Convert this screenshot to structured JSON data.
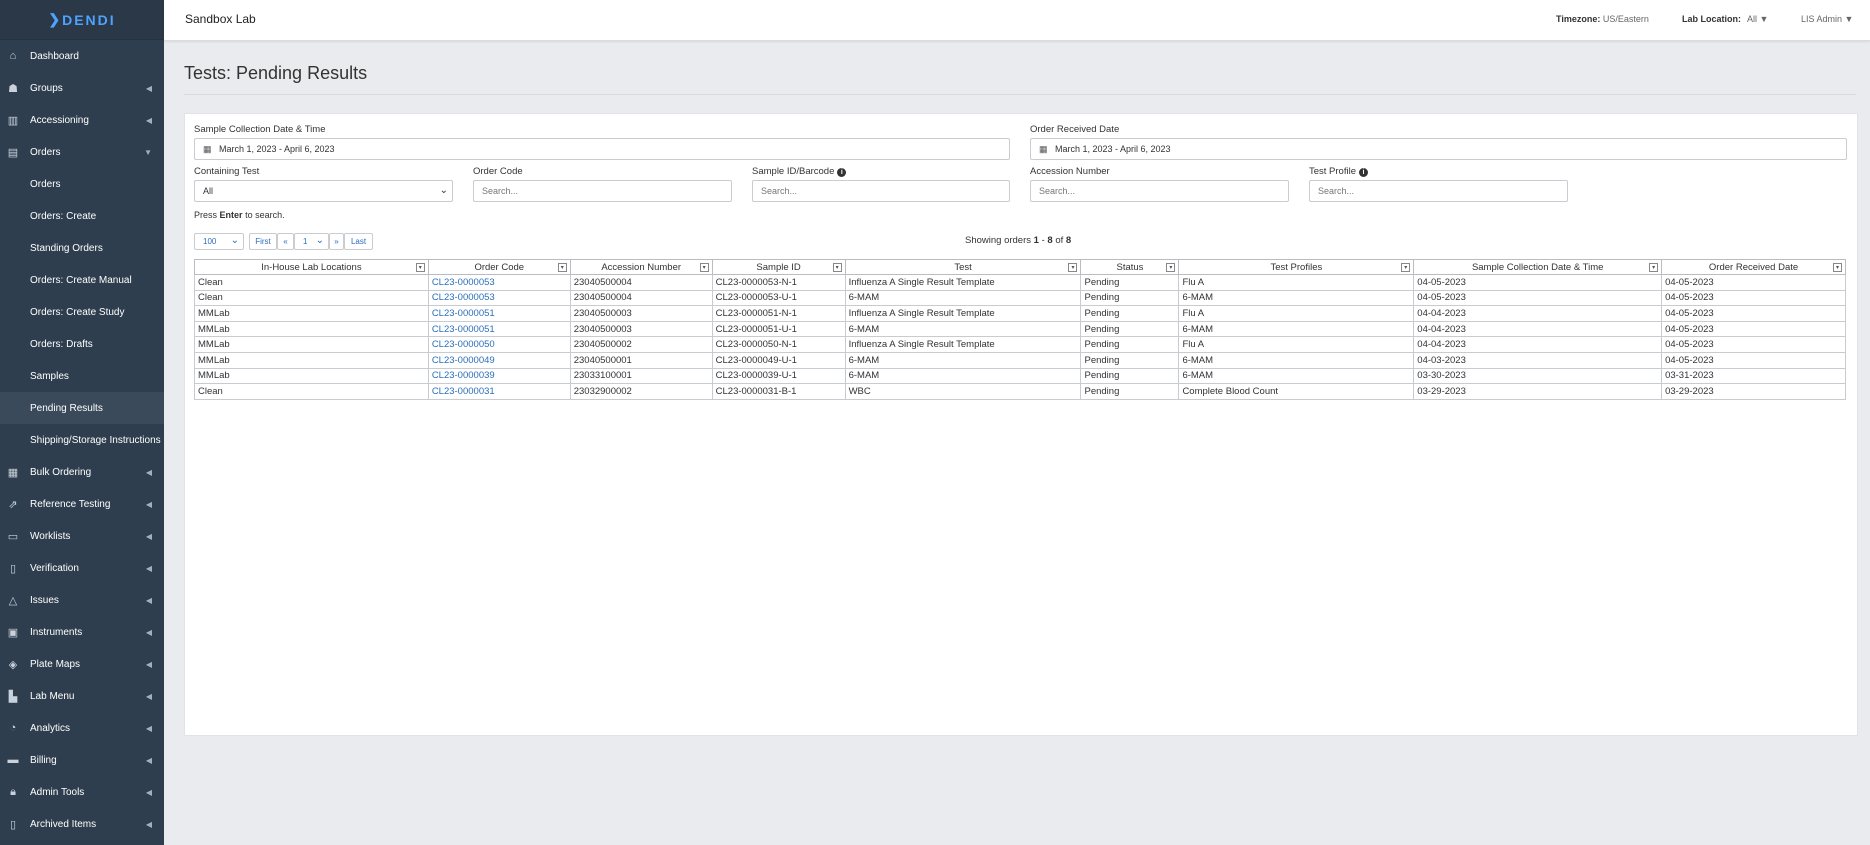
{
  "brand": {
    "logo_text": "DENDI",
    "logo_mark": "❯"
  },
  "topbar": {
    "lab_name": "Sandbox Lab",
    "timezone_label": "Timezone:",
    "timezone_value": "US/Eastern",
    "lab_location_label": "Lab Location:",
    "lab_location_value": "All ▼",
    "user": "LIS Admin ▼"
  },
  "sidebar": {
    "items": [
      {
        "label": "Dashboard",
        "icon": "home-icon"
      },
      {
        "label": "Groups",
        "icon": "users-icon"
      },
      {
        "label": "Accessioning",
        "icon": "barcode-icon"
      },
      {
        "label": "Orders",
        "icon": "list-icon"
      }
    ],
    "orders_sub": [
      {
        "label": "Orders"
      },
      {
        "label": "Orders: Create"
      },
      {
        "label": "Standing Orders"
      },
      {
        "label": "Orders: Create Manual"
      },
      {
        "label": "Orders: Create Study"
      },
      {
        "label": "Orders: Drafts"
      },
      {
        "label": "Samples"
      },
      {
        "label": "Pending Results"
      },
      {
        "label": "Shipping/Storage Instructions"
      }
    ],
    "items_after": [
      {
        "label": "Bulk Ordering",
        "icon": "table-icon"
      },
      {
        "label": "Reference Testing",
        "icon": "external-link-icon"
      },
      {
        "label": "Worklists",
        "icon": "monitor-icon"
      },
      {
        "label": "Verification",
        "icon": "file-check-icon"
      },
      {
        "label": "Issues",
        "icon": "warning-icon"
      },
      {
        "label": "Instruments",
        "icon": "server-icon"
      },
      {
        "label": "Plate Maps",
        "icon": "layers-icon"
      },
      {
        "label": "Lab Menu",
        "icon": "bar-chart-icon"
      },
      {
        "label": "Analytics",
        "icon": "gauge-icon"
      },
      {
        "label": "Billing",
        "icon": "credit-card-icon"
      },
      {
        "label": "Admin Tools",
        "icon": "lock-icon"
      },
      {
        "label": "Archived Items",
        "icon": "trash-icon"
      }
    ]
  },
  "page": {
    "title": "Tests: Pending Results"
  },
  "filters": {
    "collection_label": "Sample Collection Date & Time",
    "collection_value": "March 1, 2023 - April 6, 2023",
    "received_label": "Order Received Date",
    "received_value": "March 1, 2023 - April 6, 2023",
    "containing_test_label": "Containing Test",
    "containing_test_value": "All",
    "order_code_label": "Order Code",
    "sample_id_label": "Sample ID/Barcode",
    "accession_label": "Accession Number",
    "test_profile_label": "Test Profile",
    "search_placeholder": "Search...",
    "hint_prefix": "Press",
    "hint_key": "Enter",
    "hint_suffix": "to search."
  },
  "pager": {
    "page_size": "100",
    "first": "First",
    "prev": "«",
    "page": "1",
    "next": "»",
    "last": "Last",
    "showing_prefix": "Showing orders",
    "range_start": "1",
    "range_sep": "-",
    "range_end": "8",
    "of": "of",
    "total": "8"
  },
  "table": {
    "columns": [
      "In-House Lab Locations",
      "Order Code",
      "Accession Number",
      "Sample ID",
      "Test",
      "Status",
      "Test Profiles",
      "Sample Collection Date & Time",
      "Order Received Date"
    ],
    "rows": [
      [
        "Clean",
        "CL23-0000053",
        "23040500004",
        "CL23-0000053-N-1",
        "Influenza A Single Result Template",
        "Pending",
        "Flu A",
        "04-05-2023",
        "04-05-2023"
      ],
      [
        "Clean",
        "CL23-0000053",
        "23040500004",
        "CL23-0000053-U-1",
        "6-MAM",
        "Pending",
        "6-MAM",
        "04-05-2023",
        "04-05-2023"
      ],
      [
        "MMLab",
        "CL23-0000051",
        "23040500003",
        "CL23-0000051-N-1",
        "Influenza A Single Result Template",
        "Pending",
        "Flu A",
        "04-04-2023",
        "04-05-2023"
      ],
      [
        "MMLab",
        "CL23-0000051",
        "23040500003",
        "CL23-0000051-U-1",
        "6-MAM",
        "Pending",
        "6-MAM",
        "04-04-2023",
        "04-05-2023"
      ],
      [
        "MMLab",
        "CL23-0000050",
        "23040500002",
        "CL23-0000050-N-1",
        "Influenza A Single Result Template",
        "Pending",
        "Flu A",
        "04-04-2023",
        "04-05-2023"
      ],
      [
        "MMLab",
        "CL23-0000049",
        "23040500001",
        "CL23-0000049-U-1",
        "6-MAM",
        "Pending",
        "6-MAM",
        "04-03-2023",
        "04-05-2023"
      ],
      [
        "MMLab",
        "CL23-0000039",
        "23033100001",
        "CL23-0000039-U-1",
        "6-MAM",
        "Pending",
        "6-MAM",
        "03-30-2023",
        "03-31-2023"
      ],
      [
        "Clean",
        "CL23-0000031",
        "23032900002",
        "CL23-0000031-B-1",
        "WBC",
        "Pending",
        "Complete Blood Count",
        "03-29-2023",
        "03-29-2023"
      ]
    ]
  },
  "colors": {
    "sidebar_bg": "#2f3e4e",
    "link": "#2a6ebb",
    "brand": "#4da3ff"
  }
}
